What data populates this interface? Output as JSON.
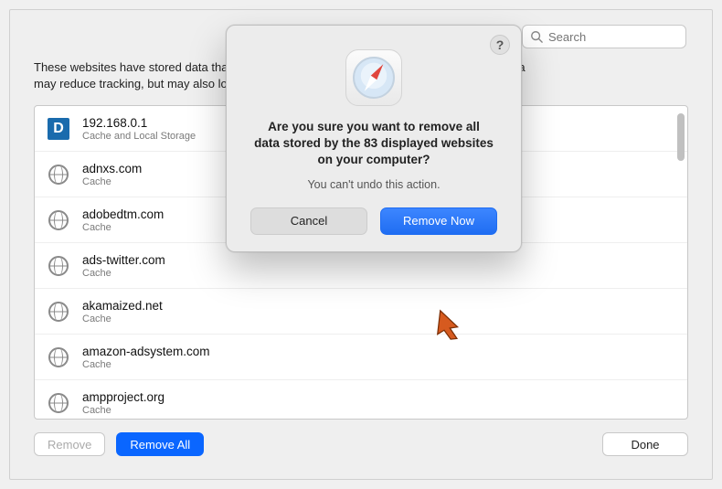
{
  "search": {
    "placeholder": "Search"
  },
  "intro_line1": "These websites have stored data that can be used to track your browsing. Removing the data",
  "intro_line2": "may reduce tracking, but may also log you out of websites or change website behavior.",
  "sites": [
    {
      "host": "192.168.0.1",
      "detail": "Cache and Local Storage",
      "icon": "d"
    },
    {
      "host": "adnxs.com",
      "detail": "Cache",
      "icon": "globe"
    },
    {
      "host": "adobedtm.com",
      "detail": "Cache",
      "icon": "globe"
    },
    {
      "host": "ads-twitter.com",
      "detail": "Cache",
      "icon": "globe"
    },
    {
      "host": "akamaized.net",
      "detail": "Cache",
      "icon": "globe"
    },
    {
      "host": "amazon-adsystem.com",
      "detail": "Cache",
      "icon": "globe"
    },
    {
      "host": "ampproject.org",
      "detail": "Cache",
      "icon": "globe"
    }
  ],
  "buttons": {
    "remove": "Remove",
    "remove_all": "Remove All",
    "done": "Done"
  },
  "alert": {
    "help": "?",
    "title": "Are you sure you want to remove all data stored by the 83 displayed websites on your computer?",
    "subtitle": "You can't undo this action.",
    "cancel": "Cancel",
    "confirm": "Remove Now"
  }
}
